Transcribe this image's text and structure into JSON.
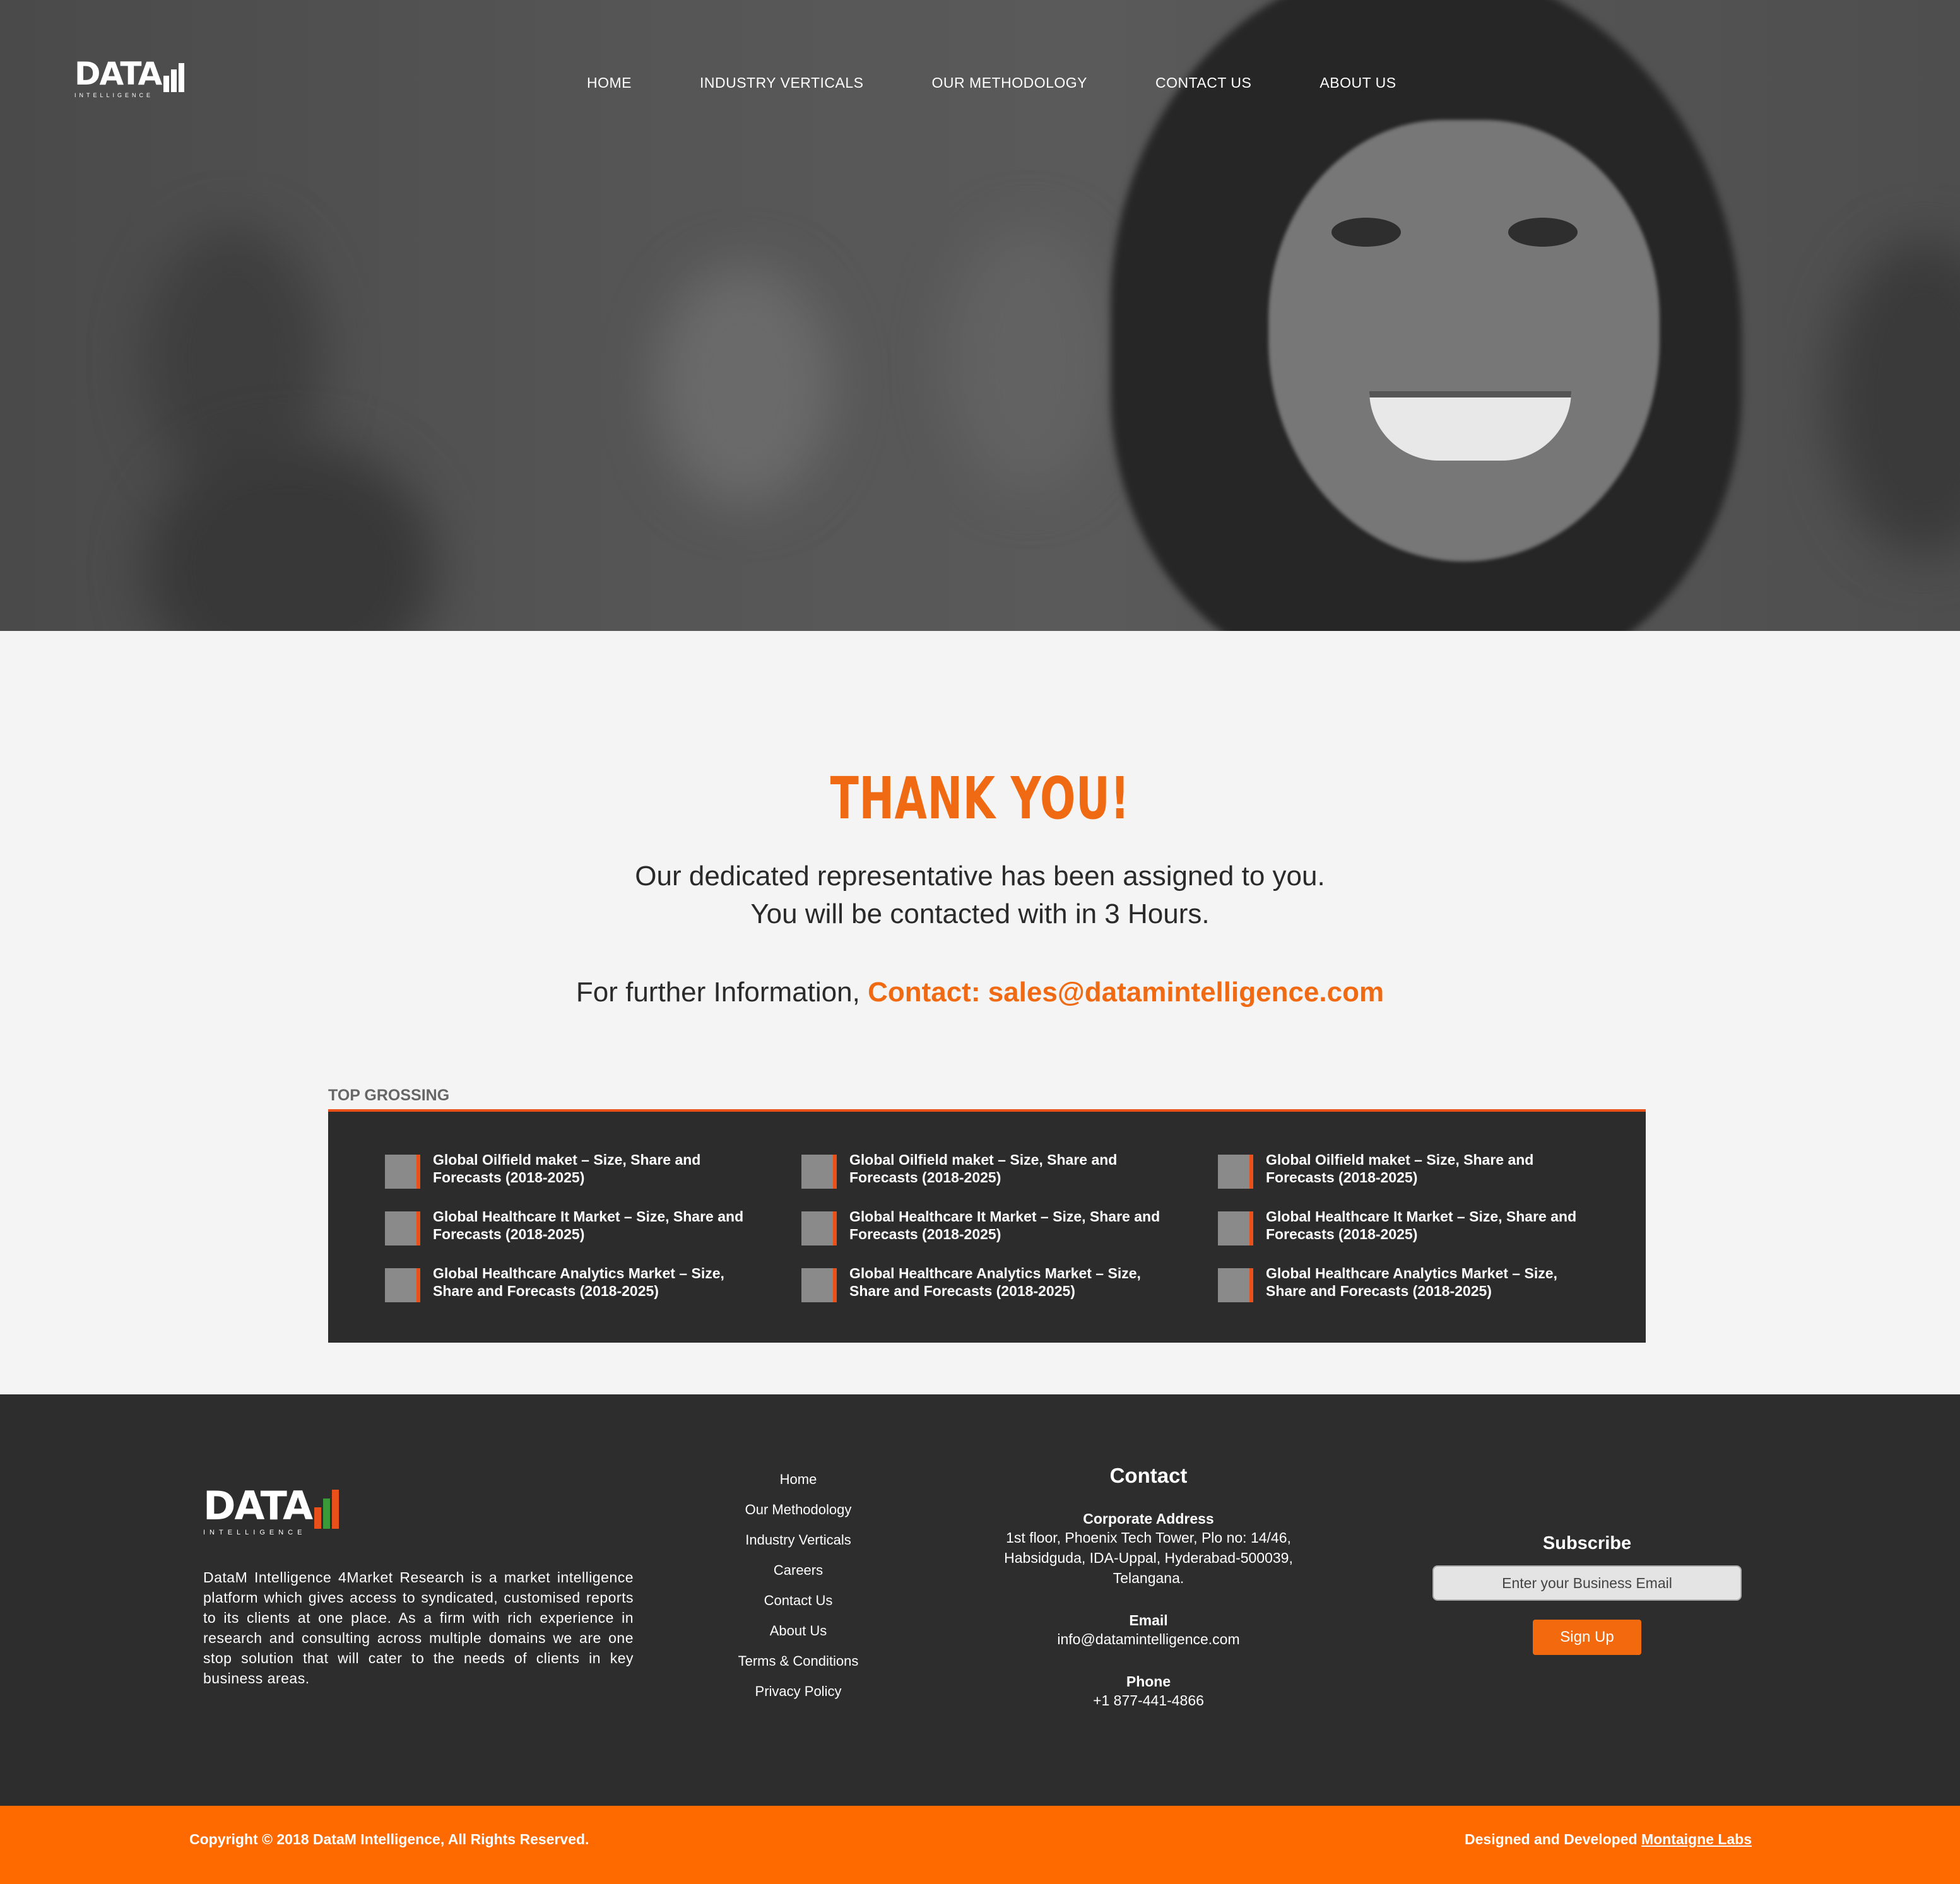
{
  "brand": {
    "logo_text": "DATA",
    "logo_sub": "INTELLIGENCE"
  },
  "nav": [
    {
      "label": "HOME"
    },
    {
      "label": "INDUSTRY VERTICALS"
    },
    {
      "label": "OUR METHODOLOGY"
    },
    {
      "label": "CONTACT US"
    },
    {
      "label": "ABOUT US"
    }
  ],
  "thankyou": {
    "title": "THANK YOU!",
    "line1": "Our dedicated representative has been assigned to you.",
    "line2": "You will be contacted with in 3 Hours.",
    "further_prefix": "For further Information, ",
    "contact_text": "Contact: sales@datamintelligence.com"
  },
  "top_grossing": {
    "title": "TOP GROSSING",
    "items": [
      "Global Oilfield maket – Size, Share and Forecasts (2018-2025)",
      "Global Oilfield maket – Size, Share and Forecasts (2018-2025)",
      "Global Oilfield maket – Size, Share and Forecasts (2018-2025)",
      "Global Healthcare It Market – Size, Share and Forecasts (2018-2025)",
      "Global Healthcare It Market – Size, Share and Forecasts (2018-2025)",
      "Global Healthcare It Market – Size, Share and Forecasts (2018-2025)",
      "Global Healthcare Analytics Market – Size, Share and Forecasts (2018-2025)",
      "Global Healthcare Analytics Market – Size, Share and Forecasts (2018-2025)",
      "Global Healthcare Analytics Market – Size, Share and Forecasts (2018-2025)"
    ]
  },
  "footer": {
    "about": "DataM Intelligence 4Market Research is a market intelligence platform which gives access to syndicated, customised reports to its clients at one place. As a firm with rich experience in research and consulting across multiple domains we are one stop solution that will cater to the needs of clients in key business areas.",
    "links": [
      "Home",
      "Our Methodology",
      "Industry Verticals",
      "Careers",
      "Contact Us",
      "About Us",
      "Terms & Conditions",
      "Privacy Policy"
    ],
    "contact": {
      "heading": "Contact",
      "address_label": "Corporate Address",
      "address_line1": "1st floor, Phoenix Tech Tower, Plo no: 14/46,",
      "address_line2": "Habsidguda, IDA-Uppal, Hyderabad-500039,",
      "address_line3": "Telangana.",
      "email_label": "Email",
      "email": "info@datamintelligence.com",
      "phone_label": "Phone",
      "phone": "+1 877-441-4866"
    },
    "subscribe": {
      "heading": "Subscribe",
      "placeholder": "Enter your Business Email",
      "button": "Sign Up"
    }
  },
  "bottom_bar": {
    "copyright": "Copyright © 2018 DataM Intelligence, All Rights Reserved.",
    "designed_prefix": "Designed and Developed ",
    "designed_link": "Montaigne Labs"
  },
  "colors": {
    "accent": "#f06a13",
    "dark": "#2d2d2d",
    "bar": "#ff6a00"
  }
}
